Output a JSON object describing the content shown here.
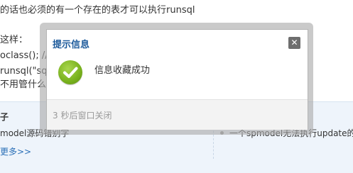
{
  "article": {
    "line1": "的话也必须的有一个存在的表才可以执行runsql",
    "line2": "这样：",
    "line3": "oclass(); //",
    "line4": "runsql(\"sql",
    "line5": "不用管什么"
  },
  "related": {
    "title": "子",
    "left_item": "model源码错别字",
    "right_item": "一个spmodel无法执行update的",
    "more": "更多>>"
  },
  "dialog": {
    "title": "提示信息",
    "close_glyph": "✕",
    "message": "信息收藏成功",
    "footer": "3 秒后窗口关闭",
    "icon": "check-circle-icon",
    "accent_color": "#1c5a9b",
    "success_color": "#78b11d"
  }
}
